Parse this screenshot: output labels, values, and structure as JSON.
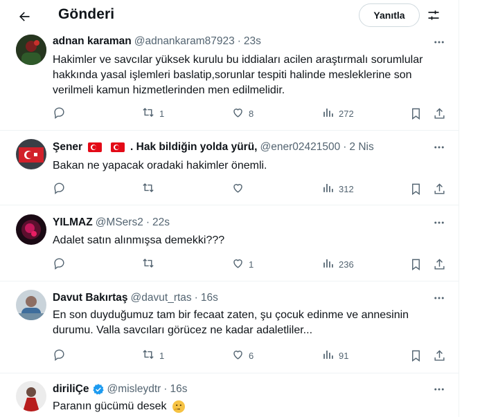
{
  "header": {
    "title": "Gönderi",
    "reply_label": "Yanıtla"
  },
  "tweets": [
    {
      "name": "adnan karaman",
      "handle": "@adnankaram87923",
      "sep": "·",
      "time": "23s",
      "text": "Hakimler ve savcılar yüksek kurulu bu iddiaları acilen araştırmalı sorumlular hakkında yasal işlemleri baslatip,sorunlar tespiti halinde mesleklerine son verilmeli kamun hizmetlerinden men edilmelidir.",
      "retweets": "1",
      "likes": "8",
      "views": "272"
    },
    {
      "name_prefix": "Şener",
      "name_suffix": ". Hak bildiğin yolda yürü,",
      "handle": "@ener02421500",
      "sep": "·",
      "time": "2 Nis",
      "text": "Bakan ne yapacak oradaki hakimler önemli.",
      "retweets": "",
      "likes": "",
      "views": "312"
    },
    {
      "name": "YILMAZ",
      "handle": "@MSers2",
      "sep": "·",
      "time": "22s",
      "text": "Adalet satın alınmışsa demekki???",
      "retweets": "",
      "likes": "1",
      "views": "236"
    },
    {
      "name": "Davut Bakırtaş",
      "handle": "@davut_rtas",
      "sep": "·",
      "time": "16s",
      "text": "En son duyduğumuz tam bir fecaat zaten, şu çocuk edinme ve annesinin durumu. Valla savcıları görücez ne kadar adaletliler...",
      "retweets": "1",
      "likes": "6",
      "views": "91"
    },
    {
      "name": "diriliÇe",
      "handle": "@misleydtr",
      "sep": "·",
      "time": "16s",
      "text": "Paranın gücümü desek"
    }
  ],
  "colors": {
    "text": "#0f1419",
    "secondary": "#536471",
    "border": "#eff3f4",
    "verified": "#1d9bf0",
    "flag": "#e30a17"
  },
  "icons": [
    "back-arrow-icon",
    "sliders-icon",
    "more-icon",
    "reply-icon",
    "retweet-icon",
    "like-icon",
    "views-icon",
    "bookmark-icon",
    "share-icon",
    "verified-icon",
    "turkish-flag-icon",
    "thinking-emoji-icon"
  ]
}
